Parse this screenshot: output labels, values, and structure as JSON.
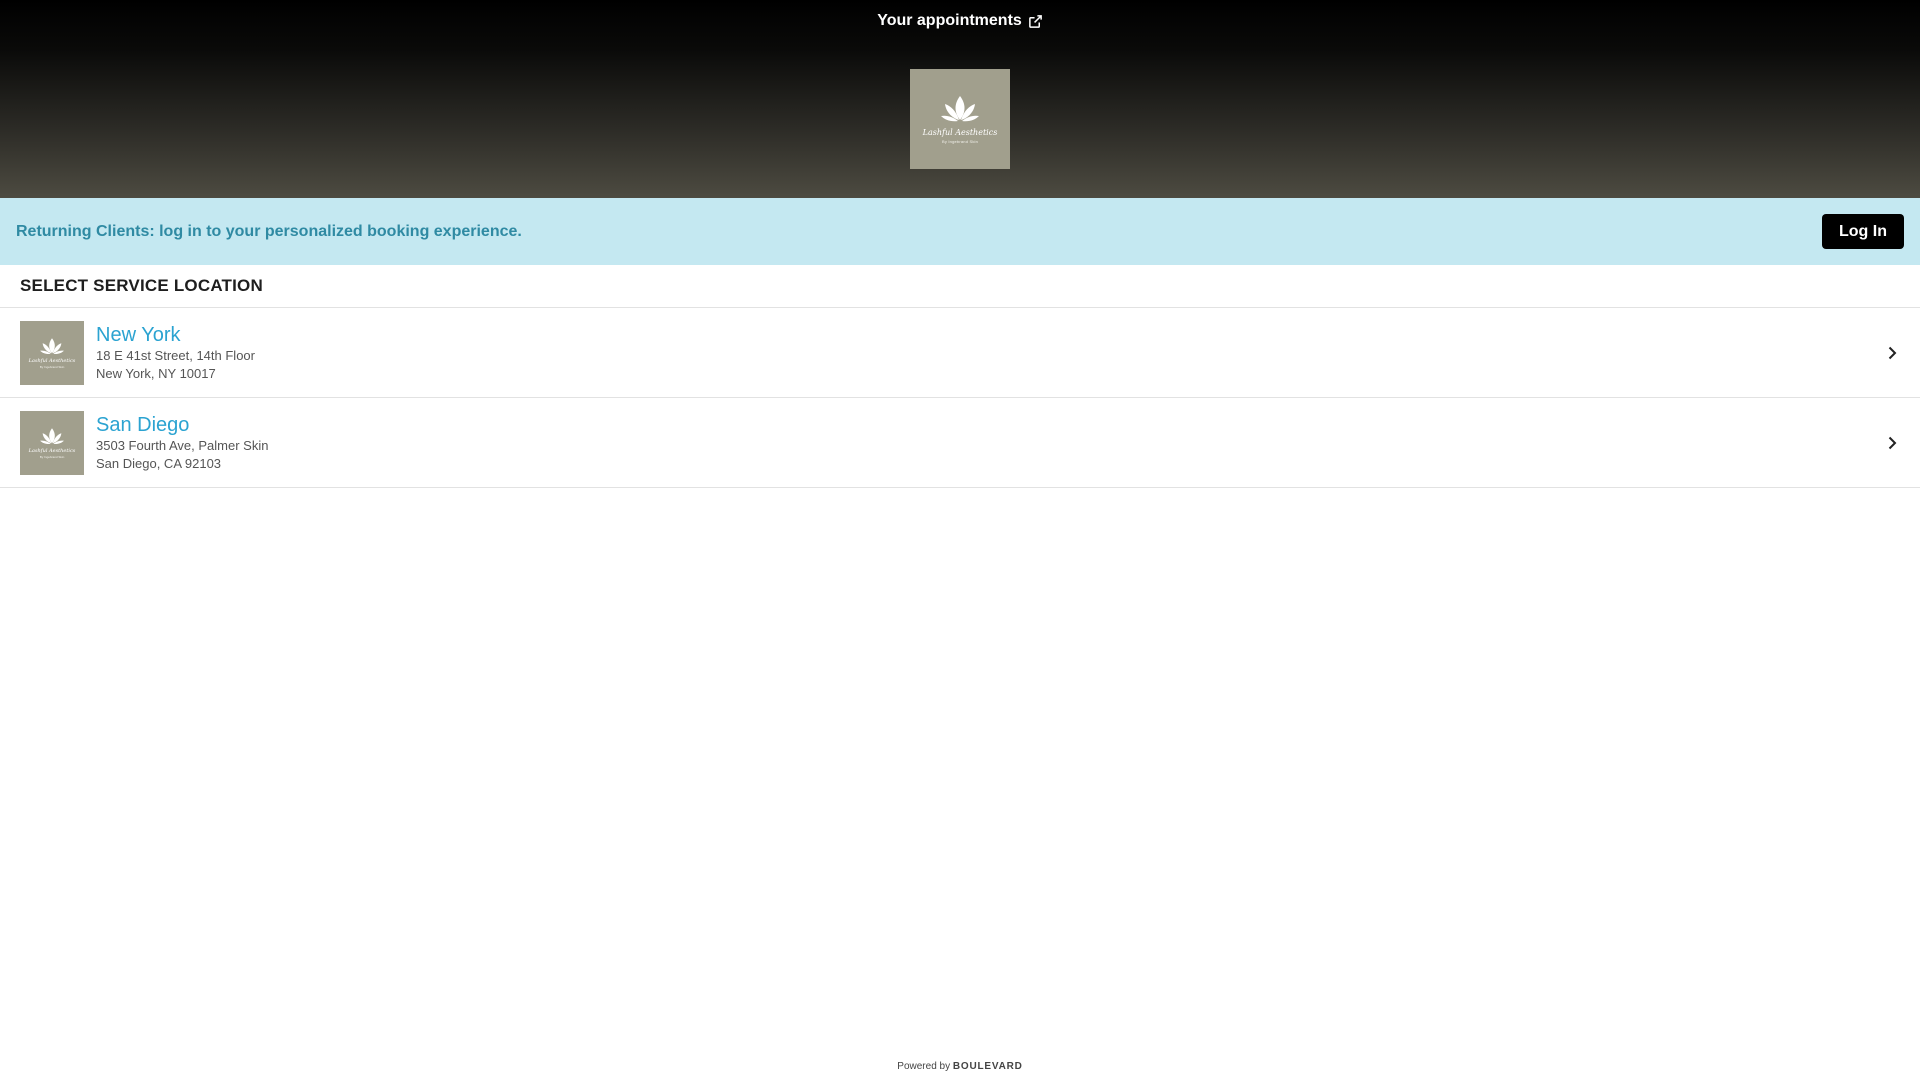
{
  "header": {
    "appointments_label": "Your appointments",
    "link_icon": "external-link-icon",
    "logo": {
      "script_text": "Lashful Aesthetics",
      "sub_text": "By Ingebrand Skin",
      "icon": "lotus-icon",
      "background": "#a19f8d"
    }
  },
  "banner": {
    "message": "Returning Clients: log in to your personalized booking experience.",
    "login_label": "Log In",
    "text_color": "#2f8aa3",
    "background": "#c4e8f1"
  },
  "locations": {
    "title": "SELECT SERVICE LOCATION",
    "items": [
      {
        "name": "New York",
        "address_line1": "18 E 41st Street, 14th Floor",
        "address_line2": "New York, NY 10017"
      },
      {
        "name": "San Diego",
        "address_line1": "3503 Fourth Ave, Palmer Skin",
        "address_line2": "San Diego, CA 92103"
      }
    ],
    "name_color": "#2ba3d1"
  },
  "footer": {
    "powered_by": "Powered by",
    "brand": "BOULEVARD"
  }
}
